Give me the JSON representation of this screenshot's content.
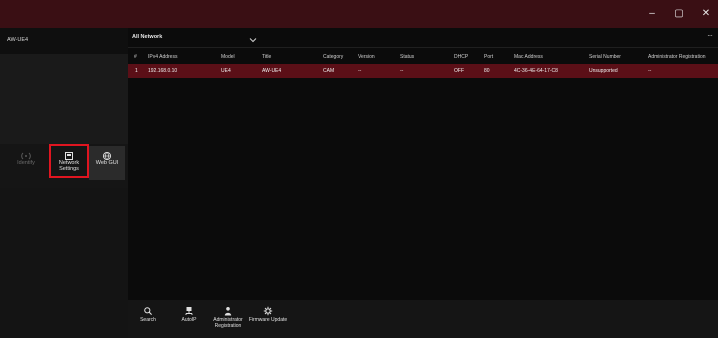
{
  "window": {
    "minimize_label": "–",
    "restore_label": "▢",
    "close_label": "✕"
  },
  "sidebar": {
    "device_name": "AW-UE4",
    "tools": [
      {
        "label": "Identify",
        "icon": "identify-icon",
        "enabled": false
      },
      {
        "label": "Network Settings",
        "icon": "network-settings-icon",
        "enabled": true,
        "highlighted": true
      },
      {
        "label": "Web GUI",
        "icon": "globe-icon",
        "enabled": true
      }
    ]
  },
  "header": {
    "network_filter": "All Network",
    "more_label": "···"
  },
  "table": {
    "columns": [
      "#",
      "IPv4 Address",
      "Model",
      "Title",
      "Category",
      "Version",
      "Status",
      "DHCP",
      "Port",
      "Mac Address",
      "Serial Number",
      "Administrator Registration"
    ],
    "rows": [
      [
        "1",
        "192.168.0.10",
        "UE4",
        "AW-UE4",
        "CAM",
        "--",
        "--",
        "OFF",
        "80",
        "4C-36-4E-64-17-C8",
        "Unsupported",
        "--"
      ]
    ]
  },
  "bottom_tools": [
    {
      "label": "Search",
      "icon": "search-icon"
    },
    {
      "label": "AutoIP",
      "icon": "autoip-icon"
    },
    {
      "label": "Administrator Registration",
      "icon": "user-icon"
    },
    {
      "label": "Firmware Update",
      "icon": "gear-icon"
    }
  ],
  "colors": {
    "titlebar": "#3a0f14",
    "selected_row": "#5b0f17",
    "highlight_border": "#e01520"
  }
}
